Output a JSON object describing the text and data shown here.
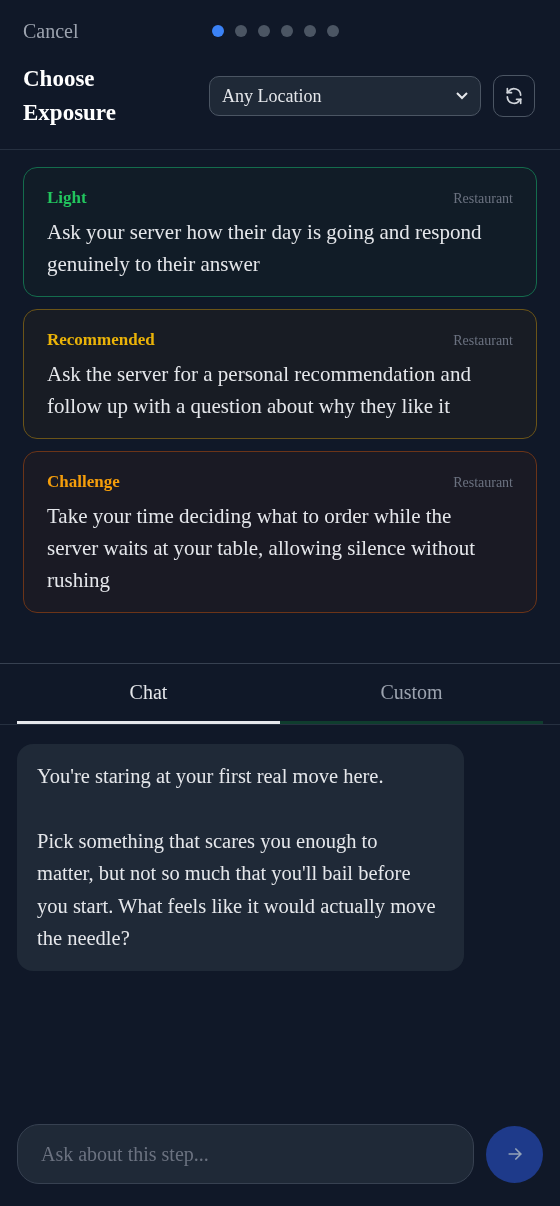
{
  "header": {
    "cancel": "Cancel",
    "steps": [
      {
        "selected": true
      },
      {
        "selected": false
      },
      {
        "selected": false
      },
      {
        "selected": false
      },
      {
        "selected": false
      },
      {
        "selected": false
      }
    ],
    "title": "Choose Exposure",
    "location": {
      "value": "Any Location"
    }
  },
  "exposures": [
    {
      "kind": "light",
      "level_label": "Light",
      "place": "Restaurant",
      "text": "Ask your server how their day is going and respond genuinely to their answer"
    },
    {
      "kind": "recommended",
      "level_label": "Recommended",
      "place": "Restaurant",
      "text": "Ask the server for a personal recommendation and follow up with a question about why they like it"
    },
    {
      "kind": "challenge",
      "level_label": "Challenge",
      "place": "Restaurant",
      "text": "Take your time deciding what to order while the server waits at your table, allowing silence without rushing"
    }
  ],
  "tabs": [
    {
      "label": "Chat",
      "selected": true
    },
    {
      "label": "Custom",
      "selected": false
    }
  ],
  "messages": [
    {
      "paragraphs": [
        "You're staring at your first real move here.",
        "Pick something that scares you enough to matter, but not so much that you'll bail before you start. What feels like it would actually move the needle?"
      ]
    }
  ],
  "composer": {
    "placeholder": "Ask about this step..."
  }
}
